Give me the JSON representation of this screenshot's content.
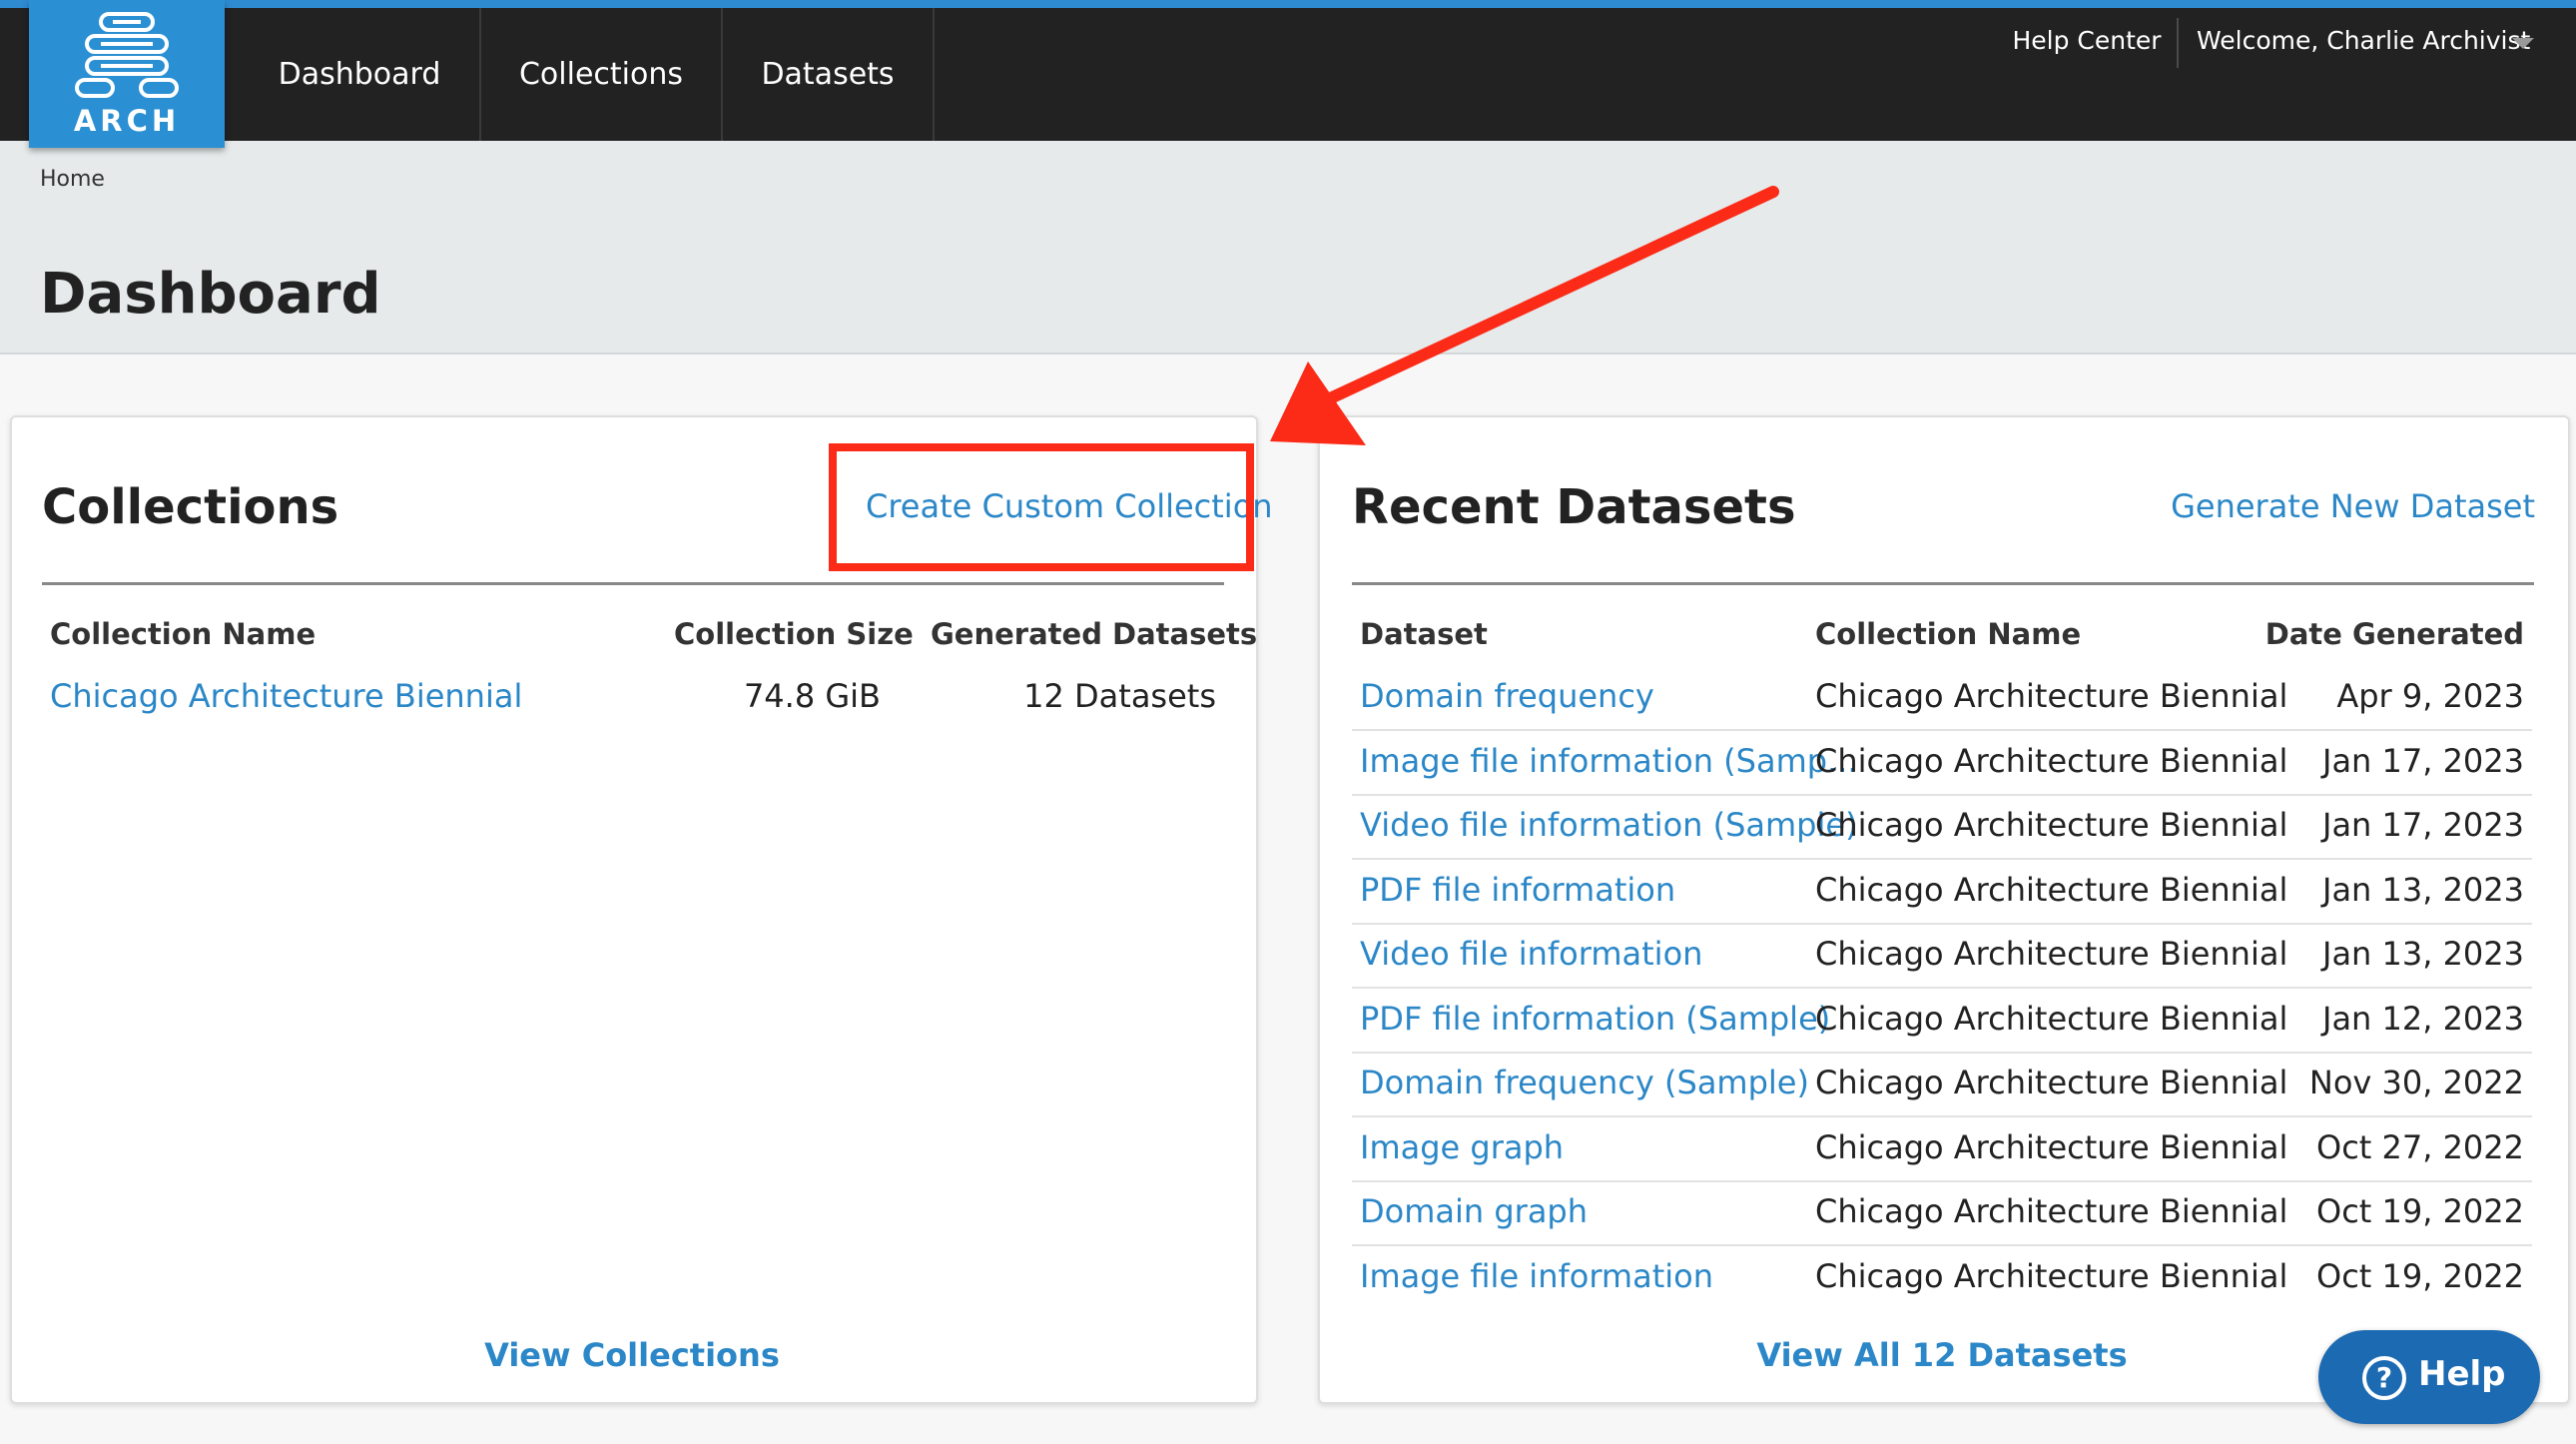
{
  "nav": {
    "logo_text": "ARCH",
    "items": [
      "Dashboard",
      "Collections",
      "Datasets"
    ],
    "help_center": "Help Center",
    "welcome": "Welcome, Charlie Archivist"
  },
  "breadcrumb": "Home",
  "page_title": "Dashboard",
  "collections_card": {
    "title": "Collections",
    "action": "Create Custom Collection",
    "headers": [
      "Collection Name",
      "Collection Size",
      "Generated Datasets"
    ],
    "rows": [
      {
        "name": "Chicago Architecture Biennial",
        "size": "74.8 GiB",
        "datasets": "12 Datasets"
      }
    ],
    "footer": "View Collections"
  },
  "datasets_card": {
    "title": "Recent Datasets",
    "action": "Generate New Dataset",
    "headers": [
      "Dataset",
      "Collection Name",
      "Date Generated"
    ],
    "rows": [
      {
        "dataset": "Domain frequency",
        "collection": "Chicago Architecture Biennial",
        "date": "Apr 9, 2023"
      },
      {
        "dataset": "Image file information (Samp...",
        "collection": "Chicago Architecture Biennial",
        "date": "Jan 17, 2023"
      },
      {
        "dataset": "Video file information (Sample)",
        "collection": "Chicago Architecture Biennial",
        "date": "Jan 17, 2023"
      },
      {
        "dataset": "PDF file information",
        "collection": "Chicago Architecture Biennial",
        "date": "Jan 13, 2023"
      },
      {
        "dataset": "Video file information",
        "collection": "Chicago Architecture Biennial",
        "date": "Jan 13, 2023"
      },
      {
        "dataset": "PDF file information (Sample)",
        "collection": "Chicago Architecture Biennial",
        "date": "Jan 12, 2023"
      },
      {
        "dataset": "Domain frequency (Sample)",
        "collection": "Chicago Architecture Biennial",
        "date": "Nov 30, 2022"
      },
      {
        "dataset": "Image graph",
        "collection": "Chicago Architecture Biennial",
        "date": "Oct 27, 2022"
      },
      {
        "dataset": "Domain graph",
        "collection": "Chicago Architecture Biennial",
        "date": "Oct 19, 2022"
      },
      {
        "dataset": "Image file information",
        "collection": "Chicago Architecture Biennial",
        "date": "Oct 19, 2022"
      }
    ],
    "footer": "View All 12 Datasets"
  },
  "help_button": "Help",
  "colors": {
    "nav_bg": "#222222",
    "brand_blue": "#2b8fd3",
    "link_blue": "#2b87c7",
    "highlight_red": "#fb2b18",
    "help_button_bg": "#1c6ab2"
  },
  "icons": [
    "arch-logo-icon",
    "caret-down-icon",
    "question-circle-icon",
    "annotation-arrow-icon"
  ]
}
